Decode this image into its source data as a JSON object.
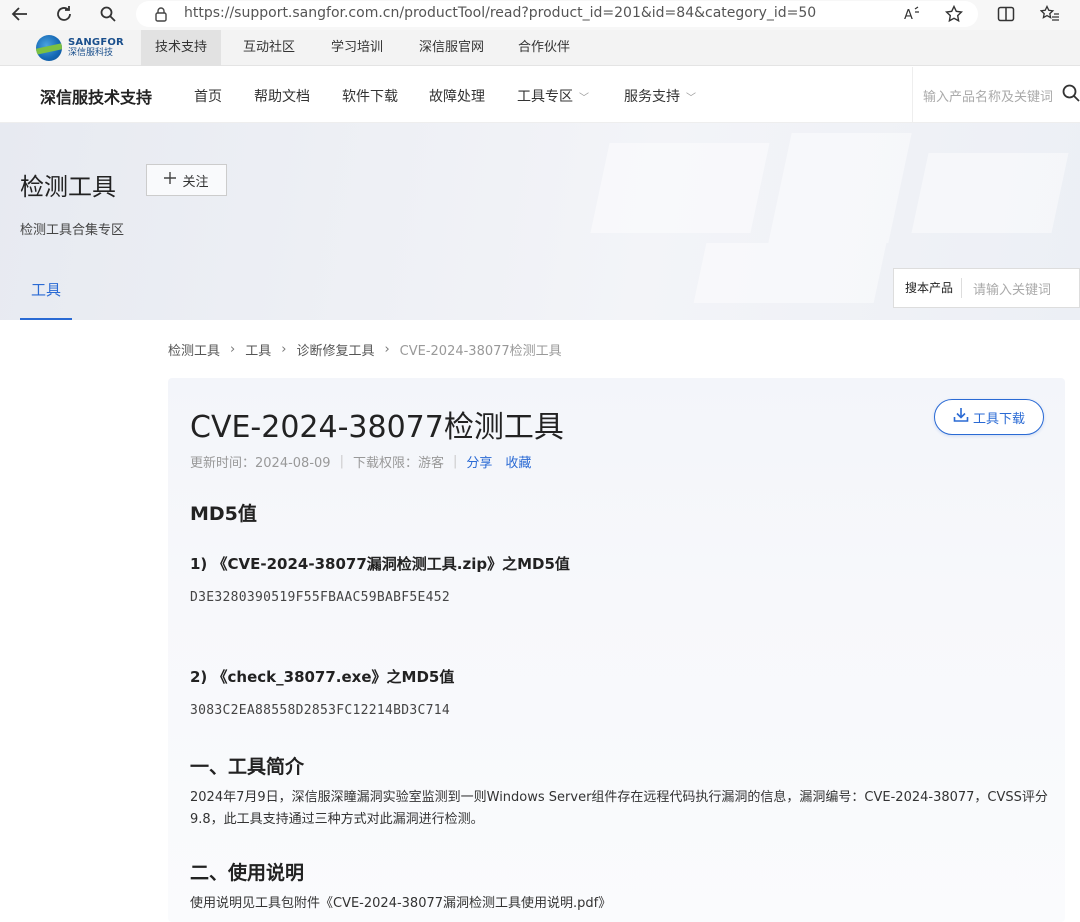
{
  "browser": {
    "url": "https://support.sangfor.com.cn/productTool/read?product_id=201&id=84&category_id=50"
  },
  "top_strip": {
    "logo_en": "SANGFOR",
    "logo_cn": "深信服科技",
    "items": [
      "技术支持",
      "互动社区",
      "学习培训",
      "深信服官网",
      "合作伙伴"
    ]
  },
  "header": {
    "site_title": "深信服技术支持",
    "nav": [
      "首页",
      "帮助文档",
      "软件下载",
      "故障处理",
      "工具专区",
      "服务支持"
    ],
    "search_placeholder": "输入产品名称及关键词"
  },
  "banner": {
    "title": "检测工具",
    "follow_label": "关注",
    "subtitle": "检测工具合集专区",
    "tab": "工具",
    "product_search_label": "搜本产品",
    "product_search_placeholder": "请输入关键词"
  },
  "breadcrumb": [
    "检测工具",
    "工具",
    "诊断修复工具",
    "CVE-2024-38077检测工具"
  ],
  "doc": {
    "title": "CVE-2024-38077检测工具",
    "updated": "更新时间：2024-08-09",
    "permission": "下载权限：游客",
    "share": "分享",
    "favorite": "收藏",
    "download_label": "工具下载",
    "md5_heading": "MD5值",
    "item1_title": "1) 《CVE-2024-38077漏洞检测工具.zip》之MD5值",
    "item1_md5": "D3E3280390519F55FBAAC59BABF5E452",
    "item2_title": "2) 《check_38077.exe》之MD5值",
    "item2_md5": "3083C2EA88558D2853FC12214BD3C714",
    "intro_heading": "一、工具简介",
    "intro_text": "2024年7月9日，深信服深瞳漏洞实验室监测到一则Windows Server组件存在远程代码执行漏洞的信息，漏洞编号：CVE-2024-38077，CVSS评分9.8，此工具支持通过三种方式对此漏洞进行检测。",
    "usage_heading": "二、使用说明",
    "usage_text": "使用说明见工具包附件《CVE-2024-38077漏洞检测工具使用说明.pdf》"
  }
}
